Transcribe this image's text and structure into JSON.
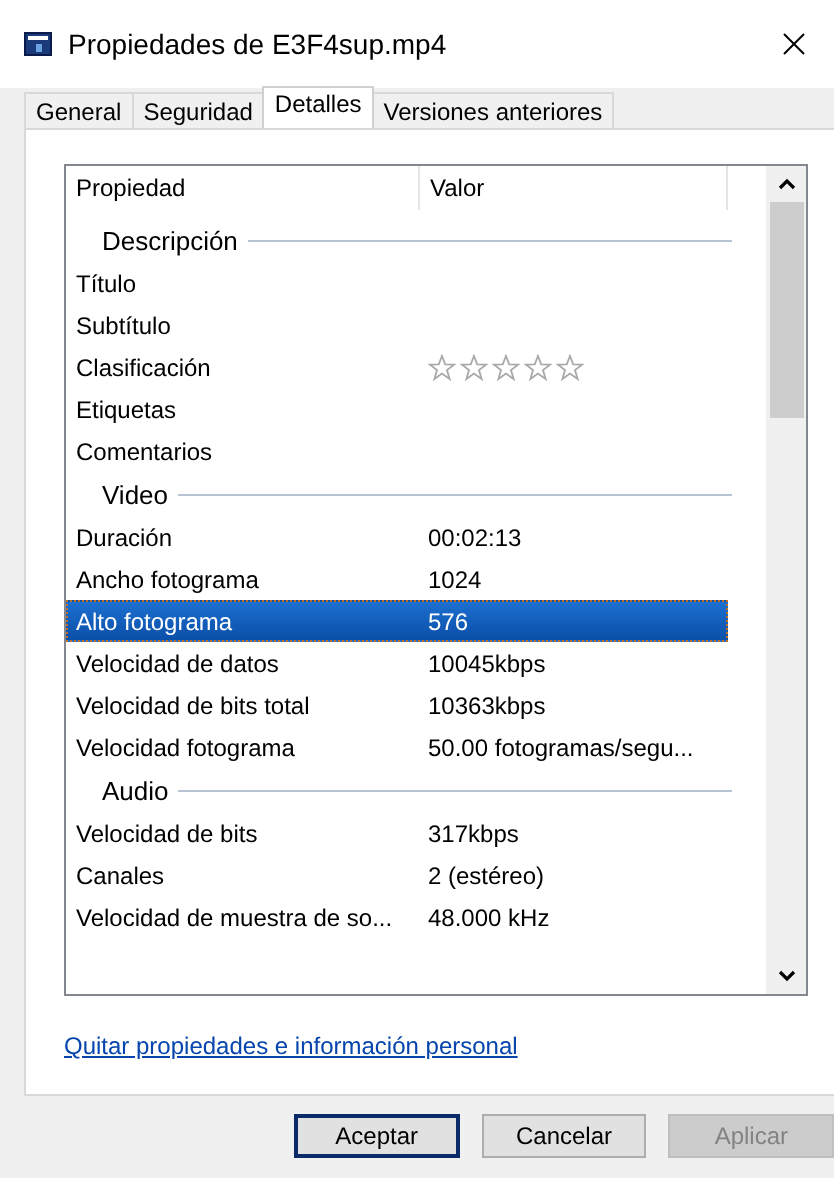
{
  "window": {
    "title": "Propiedades de E3F4sup.mp4"
  },
  "tabs": [
    {
      "label": "General",
      "selected": false
    },
    {
      "label": "Seguridad",
      "selected": false
    },
    {
      "label": "Detalles",
      "selected": true
    },
    {
      "label": "Versiones anteriores",
      "selected": false
    }
  ],
  "list": {
    "columns": [
      "Propiedad",
      "Valor"
    ],
    "groups": [
      {
        "title": "Descripción",
        "rows": [
          {
            "kind": "text",
            "property": "Título",
            "selected": false
          },
          {
            "kind": "text",
            "property": "Subtítulo",
            "selected": false
          },
          {
            "kind": "rating",
            "property": "Clasificación",
            "stars": 0,
            "selected": false
          },
          {
            "kind": "text",
            "property": "Etiquetas",
            "selected": false
          },
          {
            "kind": "text",
            "property": "Comentarios",
            "selected": false
          }
        ]
      },
      {
        "title": "Video",
        "rows": [
          {
            "kind": "text",
            "property": "Duración",
            "value": "00:02:13",
            "selected": false
          },
          {
            "kind": "text",
            "property": "Ancho fotograma",
            "value": "1024",
            "selected": false
          },
          {
            "kind": "text",
            "property": "Alto fotograma",
            "value": "576",
            "selected": true
          },
          {
            "kind": "text",
            "property": "Velocidad de datos",
            "value": "10045kbps",
            "selected": false
          },
          {
            "kind": "text",
            "property": "Velocidad de bits total",
            "value": "10363kbps",
            "selected": false
          },
          {
            "kind": "text",
            "property": "Velocidad fotograma",
            "value": "50.00 fotogramas/segu...",
            "selected": false
          }
        ]
      },
      {
        "title": "Audio",
        "rows": [
          {
            "kind": "text",
            "property": "Velocidad de bits",
            "value": "317kbps",
            "selected": false
          },
          {
            "kind": "text",
            "property": "Canales",
            "value": "2 (estéreo)",
            "selected": false
          },
          {
            "kind": "text",
            "property": "Velocidad de muestra de so...",
            "value": "48.000 kHz",
            "selected": false
          }
        ]
      }
    ]
  },
  "link": "Quitar propiedades e información personal",
  "buttons": [
    {
      "label": "Aceptar",
      "default": true,
      "disabled": false
    },
    {
      "label": "Cancelar",
      "default": false,
      "disabled": false
    },
    {
      "label": "Aplicar",
      "default": false,
      "disabled": true
    }
  ]
}
